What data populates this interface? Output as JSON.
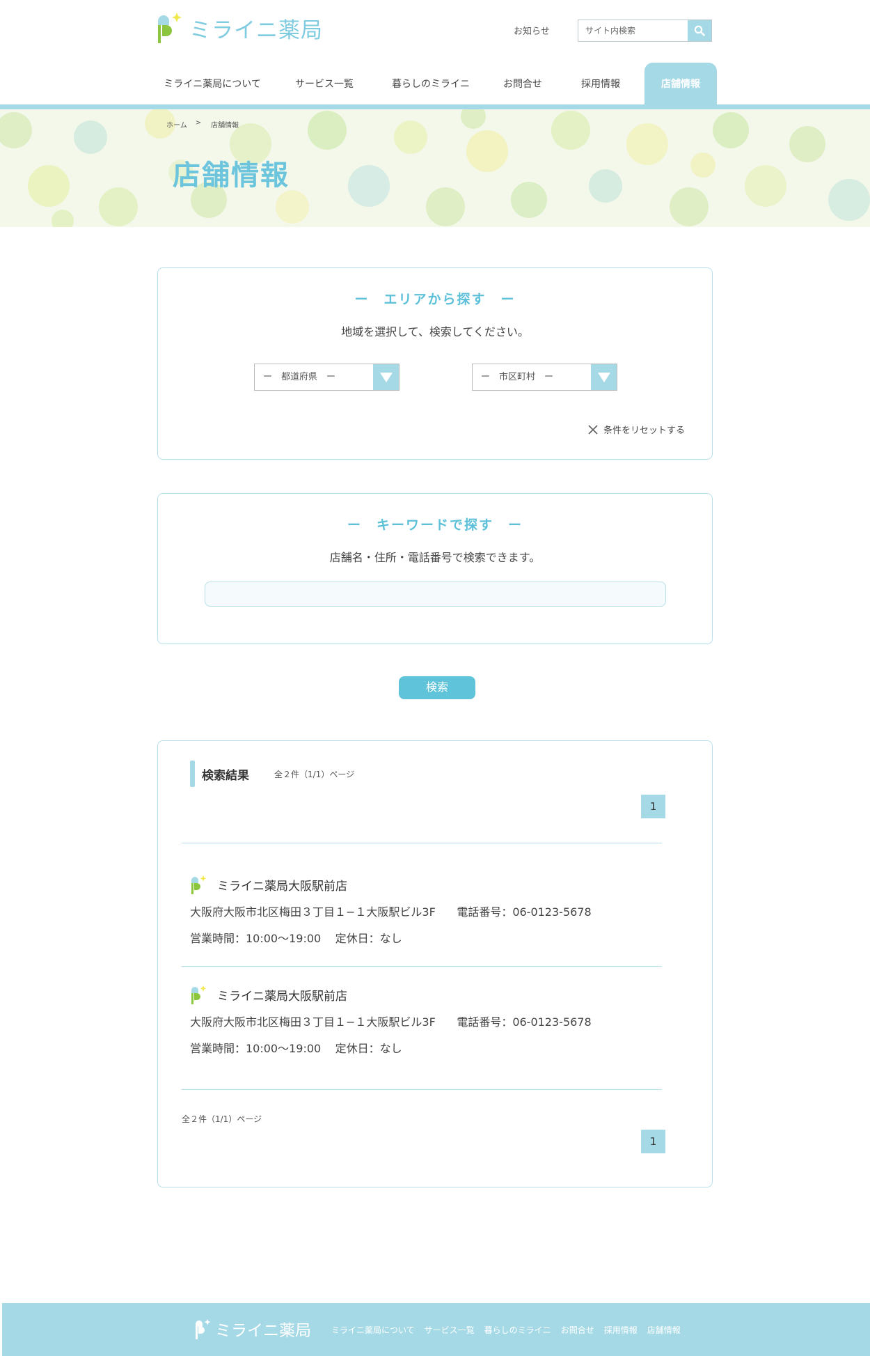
{
  "header": {
    "logo_text": "ミライニ薬局",
    "news_link": "お知らせ",
    "search_placeholder": "サイト内検索"
  },
  "nav": {
    "items": [
      {
        "label": "ミライニ薬局について"
      },
      {
        "label": "サービス一覧"
      },
      {
        "label": "暮らしのミライニ"
      },
      {
        "label": "お問合せ"
      },
      {
        "label": "採用情報"
      },
      {
        "label": "店舗情報",
        "active": true
      }
    ]
  },
  "breadcrumb": {
    "home": "ホーム",
    "separator": ">",
    "current": "店舗情報"
  },
  "hero": {
    "title": "店舗情報"
  },
  "area_search": {
    "title": "ー　エリアから探す　ー",
    "description": "地域を選択して、検索してください。",
    "prefecture_select": "ー　都道府県　ー",
    "city_select": "ー　市区町村　ー",
    "reset_label": "条件をリセットする"
  },
  "keyword_search": {
    "title": "ー　キーワードで探す　ー",
    "description": "店舗名・住所・電話番号で検索できます。",
    "input_value": ""
  },
  "search_button": "検索",
  "results": {
    "title": "検索結果",
    "count_text": "全２件（1/1）ページ",
    "page": "1",
    "stores": [
      {
        "name": "ミライニ薬局大阪駅前店",
        "address": "大阪府大阪市北区梅田３丁目１−１大阪駅ビル3F",
        "phone": "電話番号：06-0123-5678",
        "hours": "営業時間：10:00〜19:00",
        "holiday": "定休日：なし"
      },
      {
        "name": "ミライニ薬局大阪駅前店",
        "address": "大阪府大阪市北区梅田３丁目１−１大阪駅ビル3F",
        "phone": "電話番号：06-0123-5678",
        "hours": "営業時間：10:00〜19:00",
        "holiday": "定休日：なし"
      }
    ]
  },
  "footer": {
    "logo_text": "ミライニ薬局",
    "links": [
      "ミライニ薬局について",
      "サービス一覧",
      "暮らしのミライニ",
      "お問合せ",
      "採用情報",
      "店舗情報"
    ]
  },
  "colors": {
    "accent": "#a5d9e6",
    "title_blue": "#5bc0d8",
    "border": "#b8e0ea",
    "logo_green": "#8cc63f",
    "logo_yellow": "#f2e94e"
  },
  "icons": [
    "search-icon",
    "dropdown-arrow-icon",
    "close-icon",
    "store-logo-icon"
  ]
}
